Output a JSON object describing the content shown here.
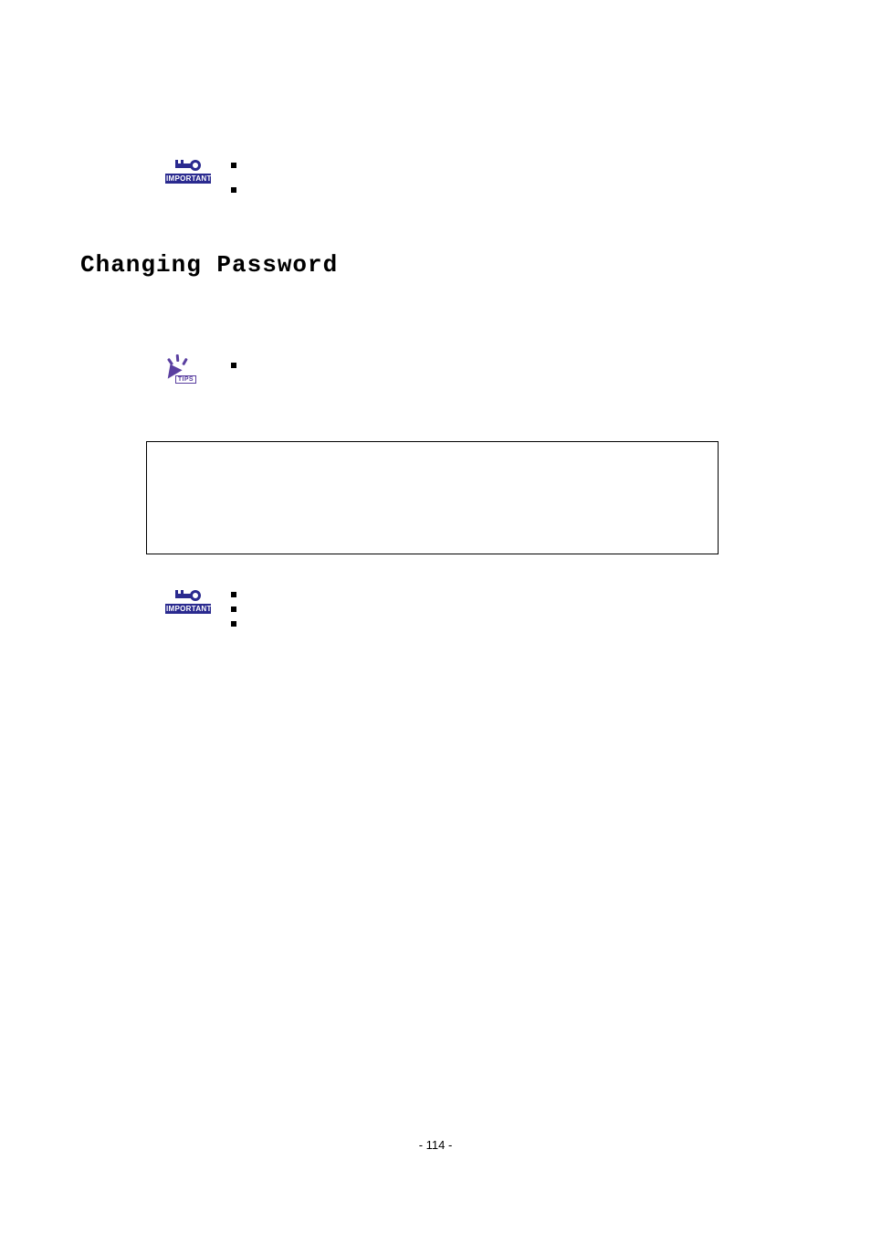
{
  "icons": {
    "important_label": "IMPORTANT",
    "tips_label": "TIPS"
  },
  "heading": "Changing Password",
  "footer": {
    "page_number": "- 114 -"
  }
}
